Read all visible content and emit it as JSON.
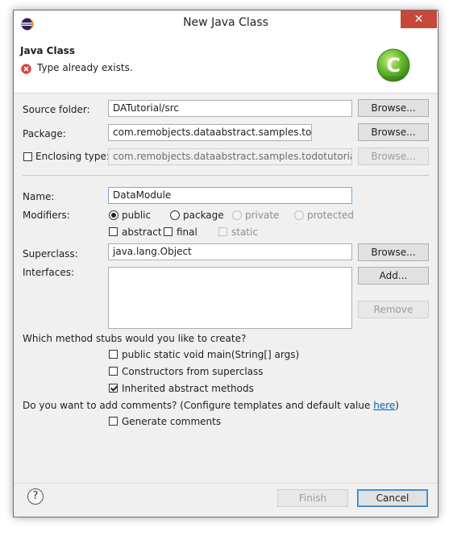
{
  "window": {
    "title": "New Java Class",
    "close_glyph": "✕"
  },
  "header": {
    "title": "Java Class",
    "error_message": "Type already exists.",
    "logo_letter": "C"
  },
  "source_folder": {
    "label": "Source folder:",
    "value": "DATutorial/src",
    "button": "Browse..."
  },
  "package": {
    "label": "Package:",
    "value": "com.remobjects.dataabstract.samples.todotut",
    "button": "Browse..."
  },
  "enclosing_type": {
    "label": "Enclosing type:",
    "value": "com.remobjects.dataabstract.samples.todotutorial.Todc",
    "button": "Browse...",
    "checked": false
  },
  "name": {
    "label": "Name:",
    "value": "DataModule"
  },
  "modifiers": {
    "label": "Modifiers:",
    "radios": [
      "public",
      "package",
      "private",
      "protected"
    ],
    "selected": "public",
    "checkboxes": [
      "abstract",
      "final",
      "static"
    ]
  },
  "superclass": {
    "label": "Superclass:",
    "value": "java.lang.Object",
    "button": "Browse..."
  },
  "interfaces": {
    "label": "Interfaces:",
    "add_button": "Add...",
    "remove_button": "Remove"
  },
  "stubs": {
    "question": "Which method stubs would you like to create?",
    "options": [
      {
        "label": "public static void main(String[] args)",
        "checked": false
      },
      {
        "label": "Constructors from superclass",
        "checked": false
      },
      {
        "label": "Inherited abstract methods",
        "checked": true
      }
    ]
  },
  "comments": {
    "question": "Do you want to add comments? (Configure templates and default value ",
    "link": "here",
    "question_end": ")",
    "option": "Generate comments"
  },
  "footer": {
    "help": "?",
    "finish": "Finish",
    "cancel": "Cancel"
  }
}
